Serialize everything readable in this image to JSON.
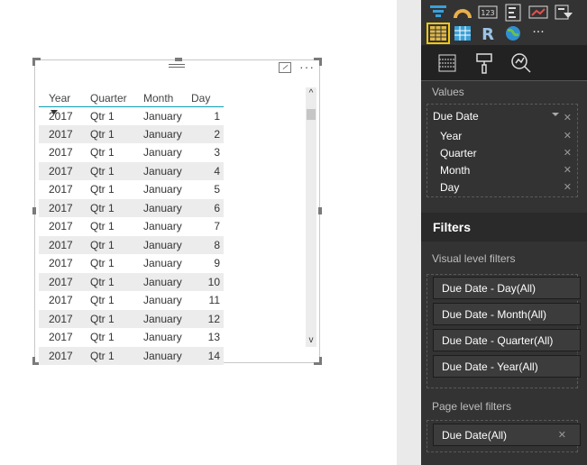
{
  "visual": {
    "columns": [
      "Year",
      "Quarter",
      "Month",
      "Day"
    ],
    "rows": [
      [
        "2017",
        "Qtr 1",
        "January",
        "1"
      ],
      [
        "2017",
        "Qtr 1",
        "January",
        "2"
      ],
      [
        "2017",
        "Qtr 1",
        "January",
        "3"
      ],
      [
        "2017",
        "Qtr 1",
        "January",
        "4"
      ],
      [
        "2017",
        "Qtr 1",
        "January",
        "5"
      ],
      [
        "2017",
        "Qtr 1",
        "January",
        "6"
      ],
      [
        "2017",
        "Qtr 1",
        "January",
        "7"
      ],
      [
        "2017",
        "Qtr 1",
        "January",
        "8"
      ],
      [
        "2017",
        "Qtr 1",
        "January",
        "9"
      ],
      [
        "2017",
        "Qtr 1",
        "January",
        "10"
      ],
      [
        "2017",
        "Qtr 1",
        "January",
        "11"
      ],
      [
        "2017",
        "Qtr 1",
        "January",
        "12"
      ],
      [
        "2017",
        "Qtr 1",
        "January",
        "13"
      ],
      [
        "2017",
        "Qtr 1",
        "January",
        "14"
      ]
    ],
    "more_glyph": "···",
    "scroll_up": "^",
    "scroll_down": "v"
  },
  "panel": {
    "icons": [
      "funnel-chart-icon",
      "gauge-icon",
      "card-icon",
      "multi-row-card-icon",
      "kpi-icon",
      "slicer-icon",
      "table-icon",
      "matrix-icon",
      "r-visual-icon",
      "globe-icon",
      "more-icon"
    ],
    "r_glyph": "R",
    "more_glyph": "···",
    "values_label": "Values",
    "values_root": "Due Date",
    "values_fields": [
      "Year",
      "Quarter",
      "Month",
      "Day"
    ],
    "remove_glyph": "✕",
    "filters_title": "Filters",
    "visual_level_label": "Visual level filters",
    "visual_filters": [
      "Due Date - Day(All)",
      "Due Date - Month(All)",
      "Due Date - Quarter(All)",
      "Due Date - Year(All)"
    ],
    "page_level_label": "Page level filters",
    "page_filter": "Due Date(All)"
  },
  "colors": {
    "accent_yellow": "#f2c811",
    "header_underline": "#0f9fb0",
    "panel_bg": "#333333"
  }
}
